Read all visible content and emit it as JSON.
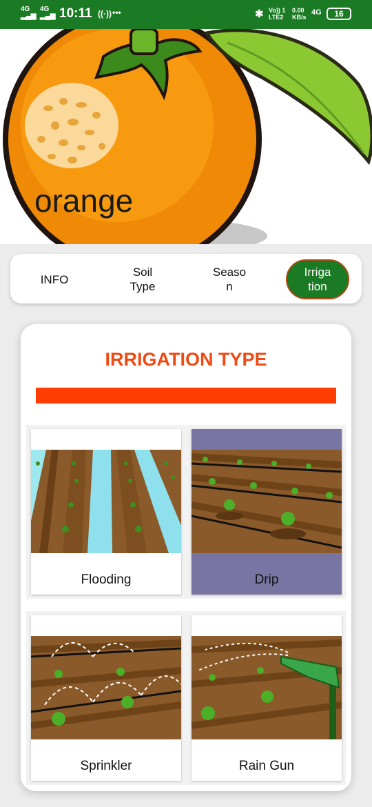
{
  "status_bar": {
    "network_1": "4G",
    "network_2": "4G",
    "time": "10:11",
    "volte": "Vo)) 1\nLTE2",
    "speed": "0.00\nKB/s",
    "network_3": "4G",
    "battery": "16"
  },
  "hero": {
    "title": "orange"
  },
  "tabs": [
    {
      "label": "INFO"
    },
    {
      "label": "Soil\nType"
    },
    {
      "label": "Seaso\nn"
    },
    {
      "label": "Irriga\ntion"
    }
  ],
  "active_tab": "Irriga\ntion",
  "section": {
    "title": "IRRIGATION TYPE"
  },
  "irrigation_types": [
    {
      "label": "Flooding",
      "icon": "flooding-field-image"
    },
    {
      "label": "Drip",
      "icon": "drip-field-image"
    },
    {
      "label": "Sprinkler",
      "icon": "sprinkler-field-image"
    },
    {
      "label": "Rain Gun",
      "icon": "rain-gun-field-image"
    }
  ],
  "selected_irrigation": "Drip",
  "colors": {
    "primary_green": "#1b7a24",
    "accent_orange": "#ee4a12",
    "bar_red": "#ff3d00",
    "selected_tile": "#7975a3"
  }
}
